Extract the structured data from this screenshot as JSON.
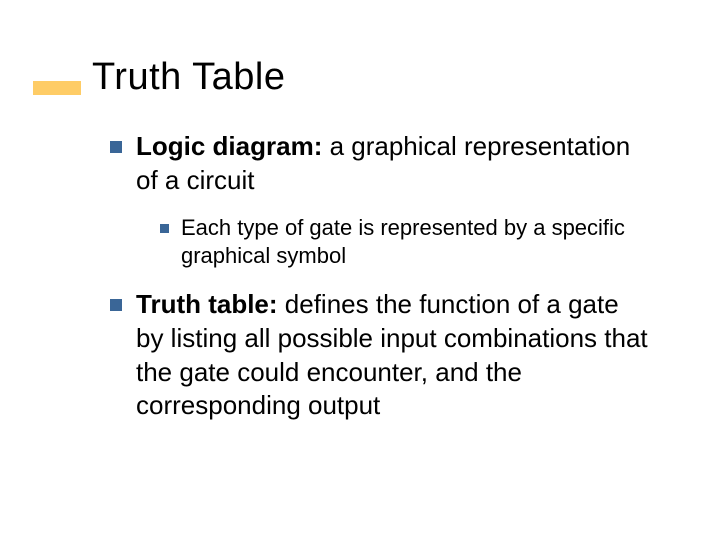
{
  "slide": {
    "title": "Truth Table",
    "bullets": [
      {
        "level": 1,
        "bold": "Logic diagram:",
        "rest": " a graphical representation of a circuit"
      },
      {
        "level": 2,
        "bold": "",
        "rest": "Each type of gate is represented by a specific graphical symbol"
      },
      {
        "level": 1,
        "bold": "Truth table:",
        "rest": " defines the function of a gate by listing all possible input combinations that the gate could encounter, and the corresponding output"
      }
    ]
  }
}
